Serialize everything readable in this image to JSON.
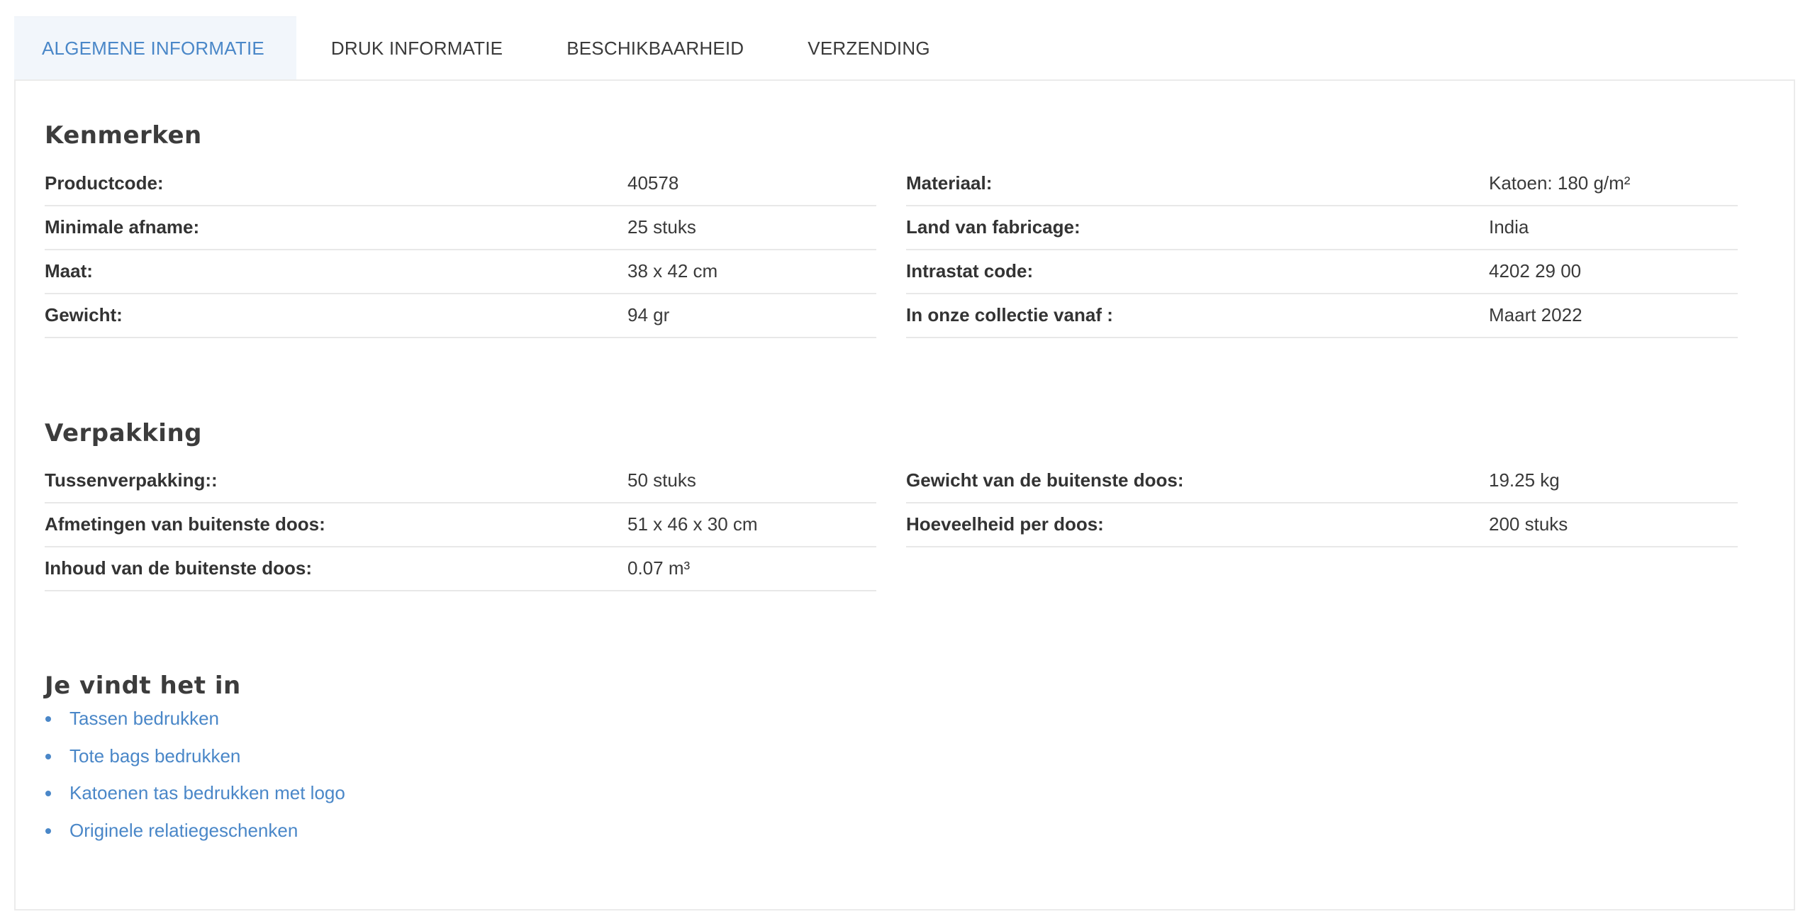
{
  "tabs": [
    {
      "label": "ALGEMENE INFORMATIE",
      "active": true
    },
    {
      "label": "DRUK INFORMATIE",
      "active": false
    },
    {
      "label": "BESCHIKBAARHEID",
      "active": false
    },
    {
      "label": "VERZENDING",
      "active": false
    }
  ],
  "colors": {
    "accent": "#4a87c8",
    "active_tab_bg": "#f2f6fb",
    "border": "#ebebeb"
  },
  "kenmerken": {
    "title": "Kenmerken",
    "left": [
      {
        "label": "Productcode:",
        "value": "40578"
      },
      {
        "label": "Minimale afname:",
        "value": "25 stuks"
      },
      {
        "label": "Maat:",
        "value": "38 x 42 cm"
      },
      {
        "label": "Gewicht:",
        "value": "94 gr"
      }
    ],
    "right": [
      {
        "label": "Materiaal:",
        "value": "Katoen: 180 g/m²"
      },
      {
        "label": "Land van fabricage:",
        "value": "India"
      },
      {
        "label": "Intrastat code:",
        "value": "4202 29 00"
      },
      {
        "label": "In onze collectie vanaf :",
        "value": "Maart 2022"
      }
    ]
  },
  "verpakking": {
    "title": "Verpakking",
    "left": [
      {
        "label": "Tussenverpakking::",
        "value": "50 stuks"
      },
      {
        "label": "Afmetingen van buitenste doos:",
        "value": "51 x 46 x 30 cm"
      },
      {
        "label": "Inhoud van de buitenste doos:",
        "value": "0.07 m³"
      }
    ],
    "right": [
      {
        "label": "Gewicht van de buitenste doos:",
        "value": "19.25 kg"
      },
      {
        "label": "Hoeveelheid per doos:",
        "value": "200 stuks"
      }
    ]
  },
  "found_in": {
    "title": "Je vindt het in",
    "links": [
      {
        "label": "Tassen bedrukken"
      },
      {
        "label": "Tote bags bedrukken"
      },
      {
        "label": "Katoenen tas bedrukken met logo"
      },
      {
        "label": "Originele relatiegeschenken"
      }
    ]
  }
}
